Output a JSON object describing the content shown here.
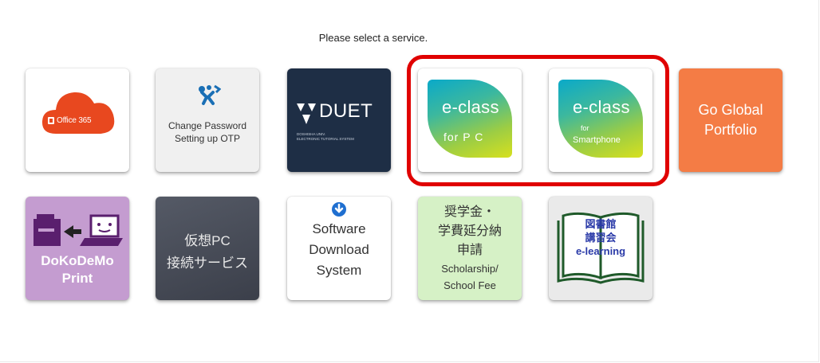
{
  "prompt": "Please select a service.",
  "colors": {
    "highlight": "#e00000",
    "office_red": "#e8481f",
    "go_global": "#f47c45",
    "dokodemo": "#c49cd0",
    "scholarship": "#d6f1c6",
    "duet_bg": "#1e2e45"
  },
  "tiles": {
    "office": {
      "label": "Office 365",
      "icon": "cloud-icon"
    },
    "password": {
      "line1": "Change Password",
      "line2": "Setting up OTP",
      "icon": "password-otp-icon"
    },
    "duet": {
      "name": "DUET",
      "sub1": "DOSHISHA UNIV.",
      "sub2": "ELECTRONIC TUTORIAL SYSTEM",
      "icon": "duet-logo-icon"
    },
    "eclass_pc": {
      "title": "e-class",
      "sub": "for P C"
    },
    "eclass_sp": {
      "title": "e-class",
      "sub_small": "for",
      "sub": "Smartphone"
    },
    "go_global": {
      "line1": "Go Global",
      "line2": "Portfolio"
    },
    "dokodemo": {
      "line1": "DoKoDeMo",
      "line2": "Print",
      "icon": "printer-laptop-icon"
    },
    "virtual_pc": {
      "line1": "仮想PC",
      "line2": "接続サービス"
    },
    "software": {
      "line1": "Software",
      "line2": "Download",
      "line3": "System",
      "icon": "download-arrow-icon"
    },
    "scholarship": {
      "jp1": "奨学金・",
      "jp2": "学費延分納",
      "jp3": "申請",
      "en1": "Scholarship/",
      "en2": "School Fee"
    },
    "library": {
      "line1": "図書館",
      "line2": "講習会",
      "line3": "e-learning",
      "icon": "open-book-icon"
    }
  }
}
